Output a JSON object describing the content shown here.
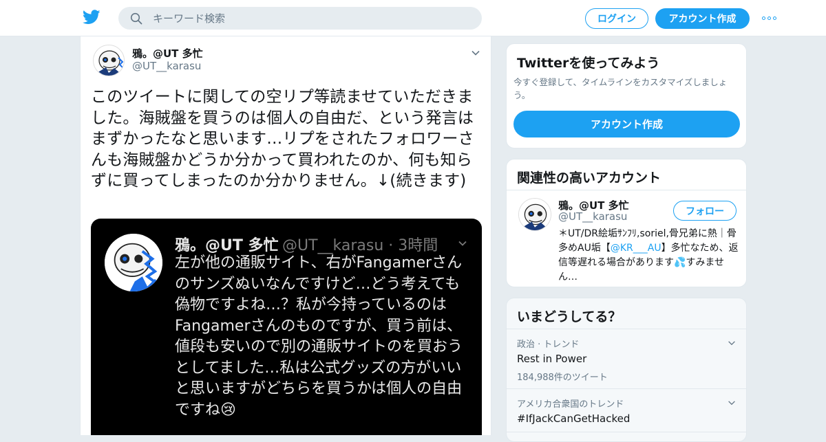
{
  "header": {
    "logo_icon": "twitter-bird-icon",
    "search_placeholder": "キーワード検索",
    "login_label": "ログイン",
    "signup_label": "アカウント作成",
    "more_icon": "more-dots-icon",
    "brand_color": "#1da1f2"
  },
  "tweet": {
    "display_name": "鴉。@UT 多忙",
    "handle": "@UT__karasu",
    "text": "このツイートに関しての空リプ等読ませていただきました。海賊盤を買うのは個人の自由だ、という発言はまずかったなと思います…リプをされたフォロワーさんも海賊盤かどうか分かって買われたのか、何も知らずに買ってしまったのか分かりません。↓(続きます)",
    "media": {
      "display_name": "鴉。@UT 多忙",
      "meta": "@UT__karasu · 3時間",
      "text": "左が他の通販サイト、右がFangamerさんのサンズぬいなんですけど…どう考えても偽物ですよね…？私が今持っているのはFangamerさんのものですが、買う前は、値段も安いので別の通販サイトのを買おうとしてました…私は公式グッズの方がいいと思いますがどちらを買うかは個人の自由ですね😢"
    }
  },
  "signup_card": {
    "title": "Twitterを使ってみよう",
    "description": "今すぐ登録して、タイムラインをカスタマイズしましょう。",
    "button_label": "アカウント作成"
  },
  "related_card": {
    "title": "関連性の高いアカウント",
    "account": {
      "display_name": "鴉。@UT 多忙",
      "handle": "@UT__karasu",
      "follow_label": "フォロー",
      "bio_before": "＊UT/DR絵垢ｻﾝﾌﾘ,soriel,骨兄弟に熱｜骨多めAU垢【",
      "bio_mention": "@KR___AU",
      "bio_after": "】多忙なため、返信等遅れる場合があります💦すみません…"
    }
  },
  "trends_card": {
    "title": "いまどうしてる？",
    "trends": [
      {
        "meta": "政治 · トレンド",
        "name": "Rest in Power",
        "count": "184,988件のツイート"
      },
      {
        "meta": "アメリカ合衆国のトレンド",
        "name": "#IfJackCanGetHacked",
        "count": ""
      }
    ]
  }
}
